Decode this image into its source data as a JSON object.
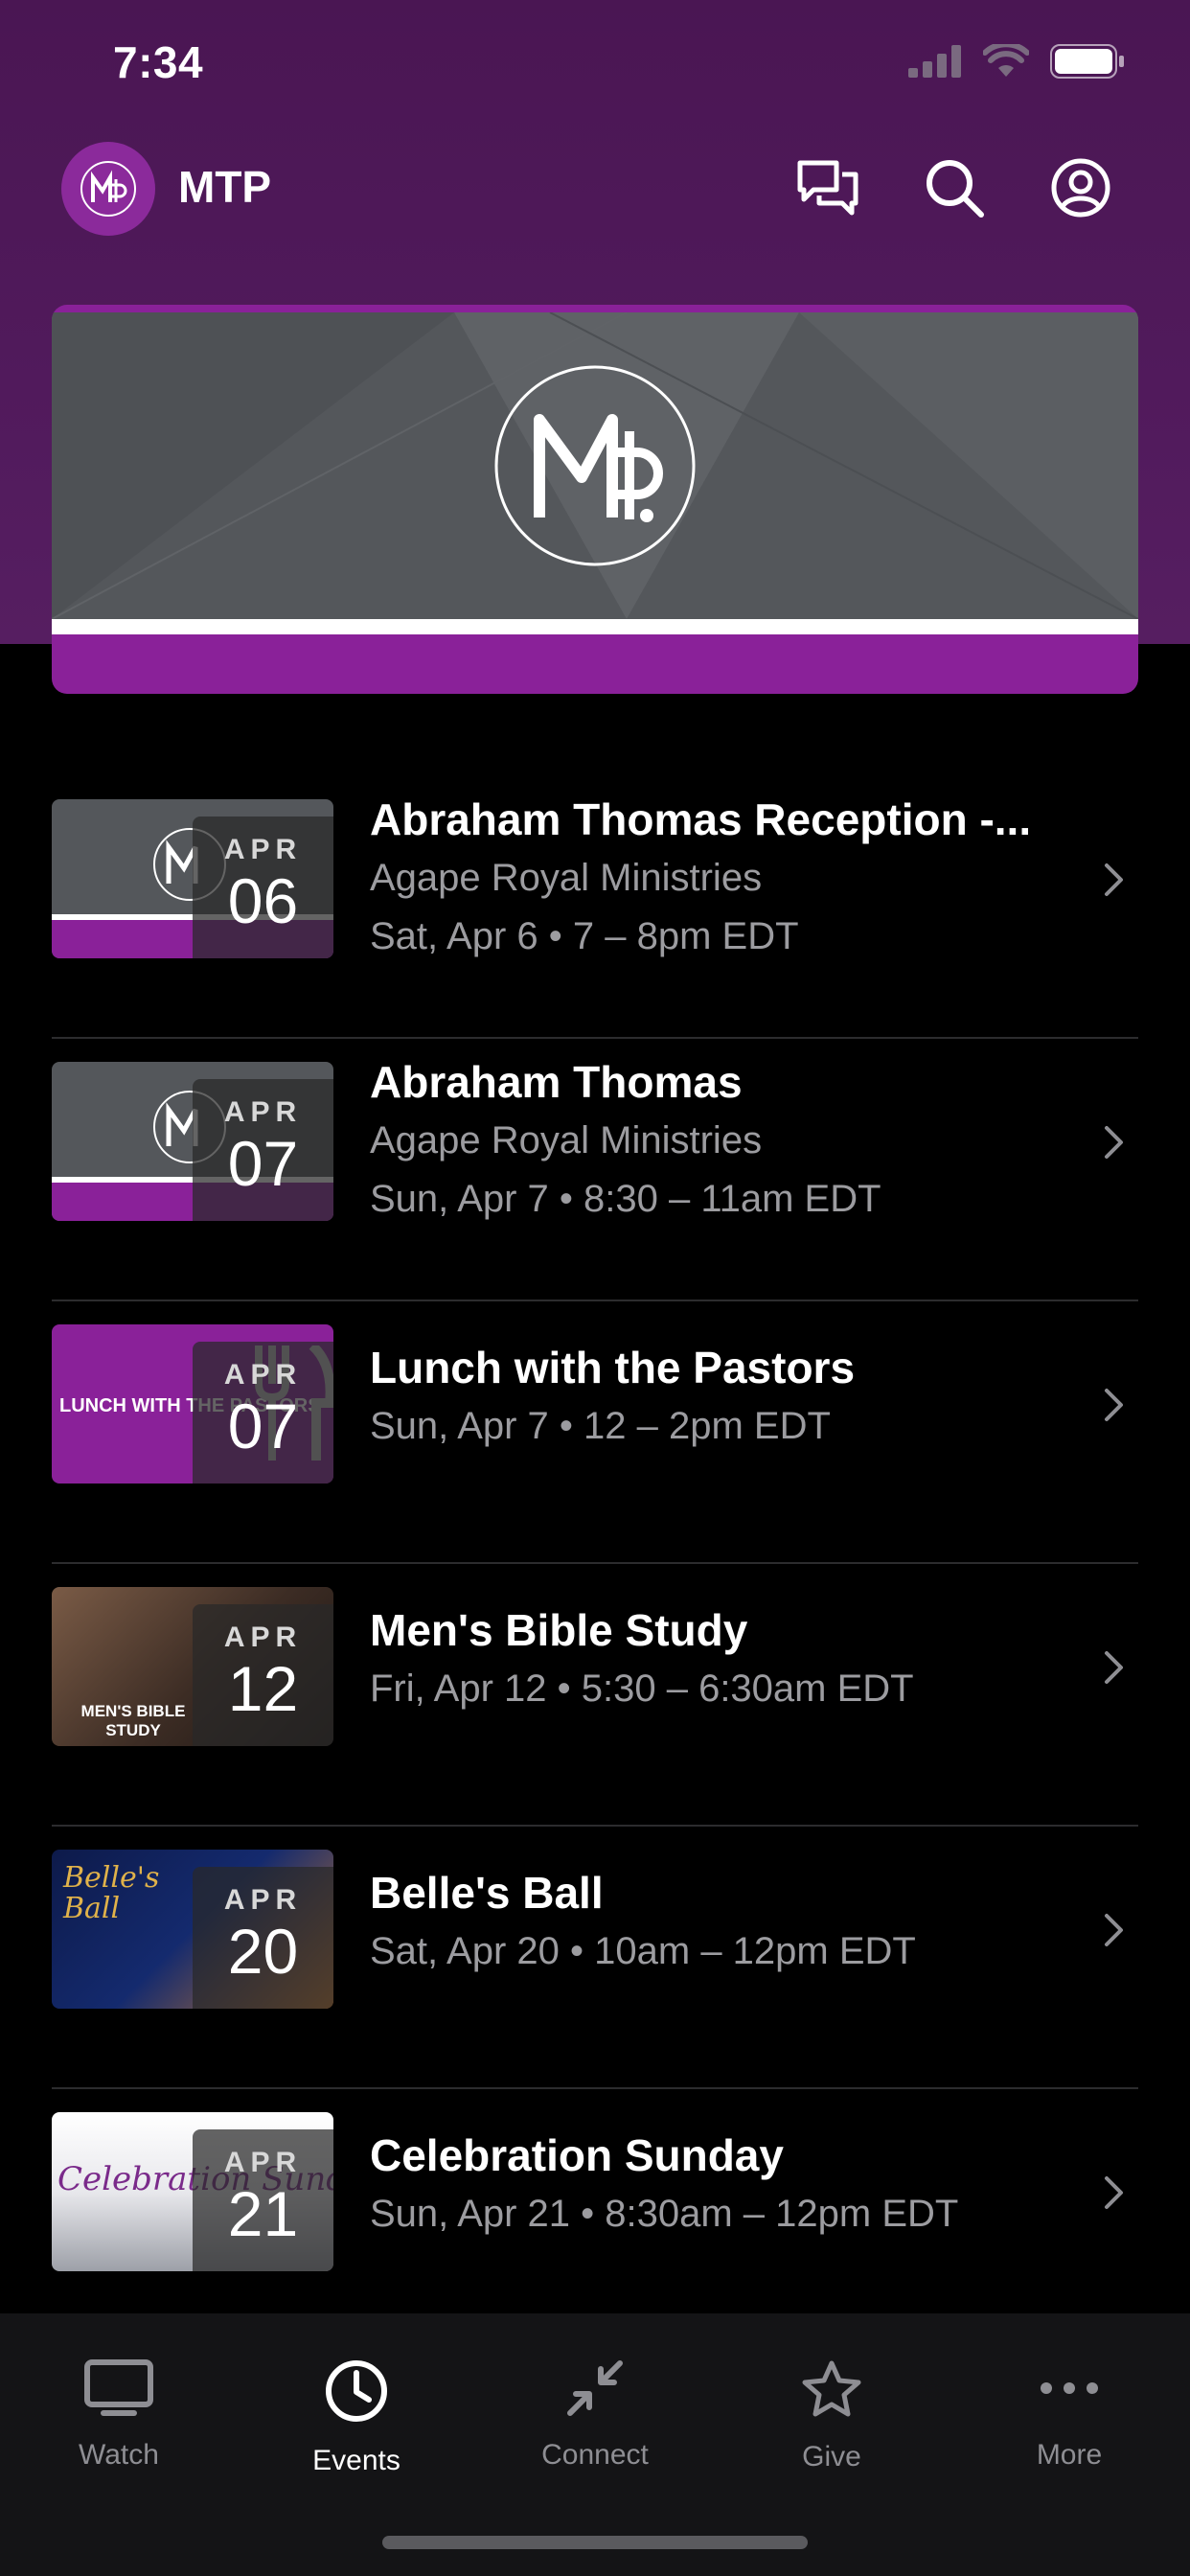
{
  "status_bar": {
    "time": "7:34"
  },
  "header": {
    "app_name": "MTP"
  },
  "events": [
    {
      "month": "APR",
      "day": "06",
      "title": "Abraham Thomas Reception -...",
      "organizer": "Agape Royal Ministries",
      "when": "Sat, Apr 6 • 7 – 8pm EDT",
      "thumb": "logo"
    },
    {
      "month": "APR",
      "day": "07",
      "title": "Abraham Thomas",
      "organizer": "Agape Royal Ministries",
      "when": "Sun, Apr 7 • 8:30 – 11am EDT",
      "thumb": "logo"
    },
    {
      "month": "APR",
      "day": "07",
      "title": "Lunch with the Pastors",
      "when": "Sun, Apr 7 • 12 – 2pm EDT",
      "thumb_text": "LUNCH WITH THE PASTORS",
      "thumb": "lunch"
    },
    {
      "month": "APR",
      "day": "12",
      "title": "Men's Bible Study",
      "when": "Fri, Apr 12 • 5:30 – 6:30am EDT",
      "thumb_text": "MEN'S BIBLE STUDY",
      "thumb": "bible"
    },
    {
      "month": "APR",
      "day": "20",
      "title": "Belle's Ball",
      "when": "Sat, Apr 20 • 10am – 12pm EDT",
      "thumb_text": "Belle's Ball",
      "thumb": "belle"
    },
    {
      "month": "APR",
      "day": "21",
      "title": "Celebration Sunday",
      "when": "Sun, Apr 21 • 8:30am – 12pm EDT",
      "thumb_text": "Celebration Sunday",
      "thumb": "celebration"
    }
  ],
  "tabs": [
    {
      "label": "Watch",
      "icon": "tv-icon",
      "active": false
    },
    {
      "label": "Events",
      "icon": "clock-icon",
      "active": true
    },
    {
      "label": "Connect",
      "icon": "connect-arrows-icon",
      "active": false
    },
    {
      "label": "Give",
      "icon": "star-icon",
      "active": false
    },
    {
      "label": "More",
      "icon": "ellipsis-icon",
      "active": false
    }
  ],
  "colors": {
    "brand_purple": "#8a2199",
    "header_bg": "#4a1653",
    "background": "#000000"
  }
}
